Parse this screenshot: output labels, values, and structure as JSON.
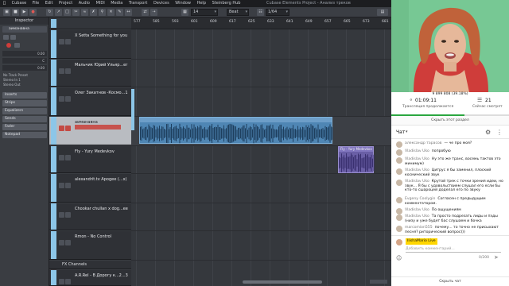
{
  "menubar": {
    "items": [
      "Cubase",
      "File",
      "Edit",
      "Project",
      "Audio",
      "MIDI",
      "Media",
      "Transport",
      "Devices",
      "Window",
      "Help",
      "Steinberg Hub"
    ],
    "window_title": "Cubase Elements Project - Анализ треков"
  },
  "toolbar": {
    "field1": "14",
    "field2": "Beat",
    "field3": "1/64"
  },
  "inspector": {
    "title": "Inspector",
    "track_name": "аиманавна",
    "knobs": [
      {
        "label": "",
        "value": "0.00"
      },
      {
        "label": "",
        "value": "C"
      },
      {
        "label": "",
        "value": "0.00"
      }
    ],
    "channels": [
      "No Track Preset",
      "Stereo In 1",
      "Stereo Out"
    ],
    "sections": [
      "Inserts",
      "Strips",
      "Equalizers",
      "Sends",
      "Fader",
      "Notepad"
    ]
  },
  "tracks": [
    {
      "name": "X Setta Something for you",
      "selected": false
    },
    {
      "name": "Мальчик Юрий Ульяр...er",
      "selected": false
    },
    {
      "name": "Олег Закатнов -Космо...1",
      "selected": false
    },
    {
      "name": "аиманавна",
      "selected": true
    },
    {
      "name": "Fly - Yury Medevkov",
      "selected": false
    },
    {
      "name": "alexandrit.tv Apogee (...x)",
      "selected": false
    },
    {
      "name": "Chookar chullan x dog...ee",
      "selected": false
    },
    {
      "name": "Rmon - No Control",
      "selected": false
    },
    {
      "name": "FX Channels",
      "selected": false,
      "folder": true
    },
    {
      "name": "A.R.Rel - В Дорогу к...2...3",
      "selected": false
    }
  ],
  "ruler": {
    "ticks": [
      "577",
      "585",
      "593",
      "601",
      "609",
      "617",
      "625",
      "633",
      "641",
      "649",
      "657",
      "665",
      "673",
      "681"
    ]
  },
  "clips": {
    "main_title": "",
    "small_title": "Fly - Yury Medevkov"
  },
  "stream": {
    "top_line": "9 899 808 (39.18%)",
    "duration": "01:09:11",
    "duration_label": "Трансляция продолжается",
    "viewers": "21",
    "viewers_label": "Сейчас смотрят",
    "timeline_fraction": 0.62,
    "hide_section": "Скрыть этот раздел"
  },
  "chat": {
    "title": "Чат",
    "messages": [
      {
        "author": "александр тарасов",
        "text": "— че про моя?"
      },
      {
        "author": "Vladislav Uko",
        "text": "попробую"
      },
      {
        "author": "Vladislav Uko",
        "text": "Ну это же транс, восемь тактов это минимум)"
      },
      {
        "author": "Vladislav Uko",
        "text": "Цитрус я бы заменил, плоский космический звук"
      },
      {
        "author": "Vladislav Uko",
        "text": "Крутой трек с точки зрения идеи, но звук... Я бы с удовольствием слушал его если бы кто-то сшароцей доделал его по звуку"
      },
      {
        "author": "Evgeny Coolygin",
        "text": "Согласен с предыдущим комментатором."
      },
      {
        "author": "Vladislav Uko",
        "text": "По ощущениям"
      },
      {
        "author": "Vladislav Uko",
        "text": "Та просто подрезать лиды и пэды (низу и уже будет бас слушаем и бочка"
      },
      {
        "author": "marcomion555",
        "text": "почему... то точно не присыхают песня? риторический вопрос)))"
      }
    ],
    "me_name": "IlishaMario Live",
    "input_placeholder": "Добавить комментарий...",
    "counter": "0/200",
    "hide_chat": "Скрыть чат"
  }
}
